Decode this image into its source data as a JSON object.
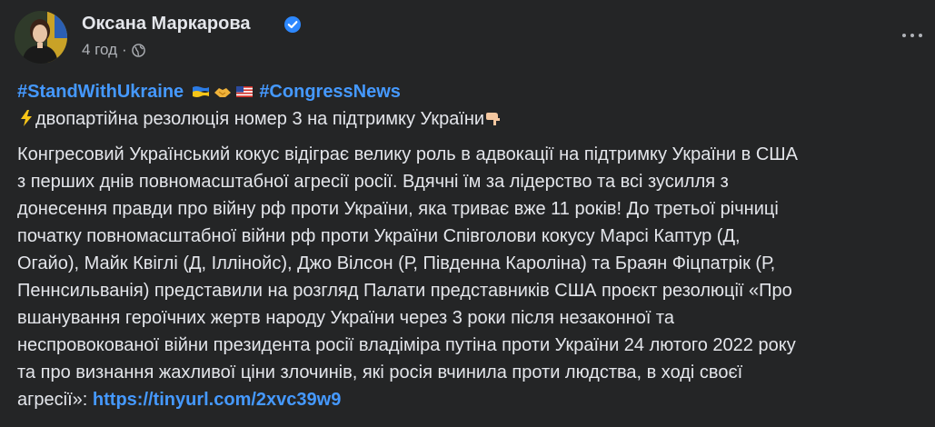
{
  "post": {
    "author": {
      "name": "Оксана Маркарова",
      "verified_icon": "verified-badge-icon",
      "avatar_icon": "profile-photo"
    },
    "meta": {
      "time": "4 год",
      "separator": "·",
      "audience_icon": "globe-icon"
    },
    "menu_icon": "more-options-icon",
    "hashtags": {
      "first": "#StandWithUkraine",
      "second": "#CongressNews",
      "emojis": [
        "ukraine-flag",
        "handshake",
        "us-flag"
      ]
    },
    "headline": {
      "emoji_left": "lightning-icon",
      "text": "двопартійна резолюція номер 3 на підтримку України",
      "emoji_right": "pointing-down-hand-icon"
    },
    "body_lines": [
      "Конгресовий Український кокус відіграє велику роль в адвокації на підтримку України в США",
      "з перших днів повномасштабної агресії росії. Вдячні їм за лідерство та всі зусилля з",
      "донесення правди про війну рф проти України, яка триває вже 11 років! До третьої річниці",
      "початку повномасштабної війни рф проти України Співголови кокусу Марсі Каптур (Д,",
      "Огайо), Майк Квіглі (Д, Іллінойс), Джо Вілсон (Р, Південна Кароліна) та Браян Фіцпатрік (Р,",
      "Пеннсильванія) представили на розгляд Палати представників США проєкт резолюції «Про",
      "вшанування героїчних жертв народу України через 3 роки після незаконної та",
      "неспровокованої війни президента росії владіміра путіна проти України 24 лютого 2022 року",
      "та про визнання жахливої ціни злочинів, які росія вчинила проти людства, в ході своєї"
    ],
    "last_line_prefix": "агресії»: ",
    "link": "https://tinyurl.com/2xvc39w9"
  },
  "colors": {
    "background": "#242526",
    "text": "#e4e6eb",
    "muted": "#b0b3b8",
    "link": "#4599ff",
    "verified": "#2d88ff"
  }
}
